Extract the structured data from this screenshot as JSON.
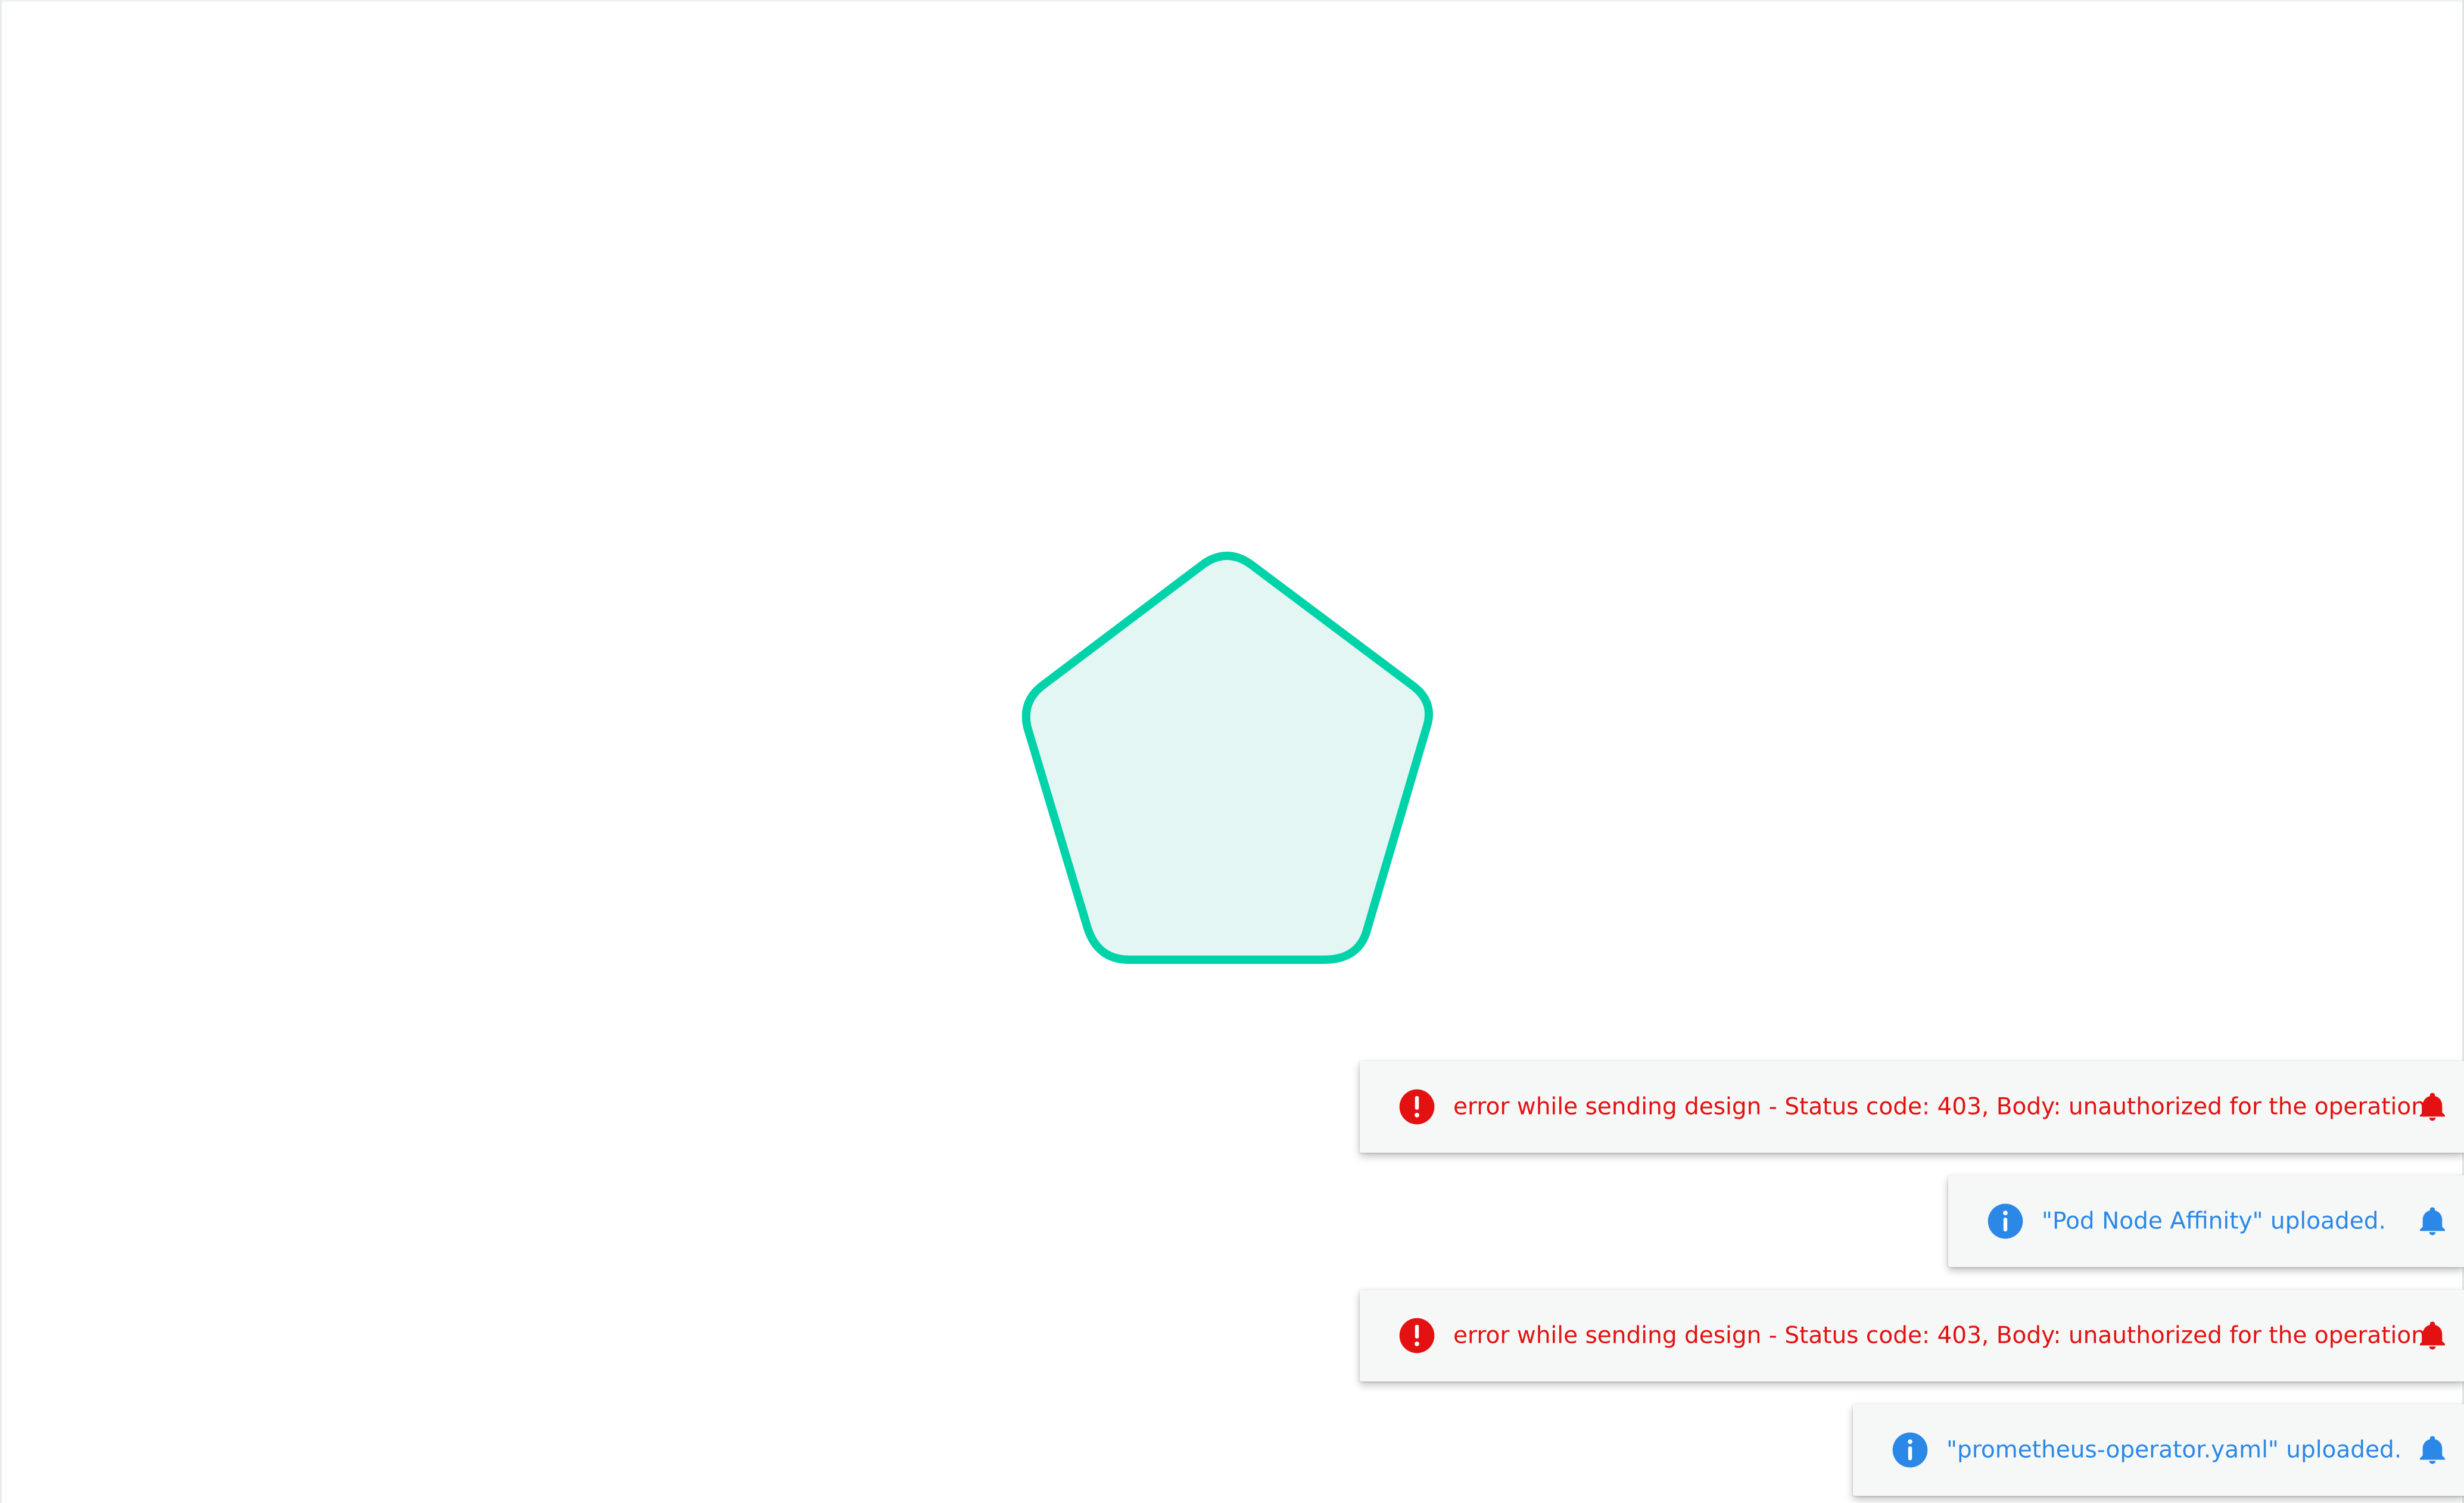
{
  "colors": {
    "accent": "#00d3a9",
    "canvas_background": "#ffffff",
    "error": "#e31111",
    "info": "#2b88e7"
  },
  "canvas": {
    "shape": "pentagon",
    "shape_icon": "pentagon-icon"
  },
  "notifications": [
    {
      "type": "error",
      "status_icon": "error-icon",
      "message": "error while sending design - Status code: 403, Body: unauthorized for the operation",
      "action_icon": "bell-icon"
    },
    {
      "type": "info",
      "status_icon": "info-icon",
      "message": "\"Pod Node Affinity\" uploaded.",
      "action_icon": "bell-icon"
    },
    {
      "type": "error",
      "status_icon": "error-icon",
      "message": "error while sending design - Status code: 403, Body: unauthorized for the operation",
      "action_icon": "bell-icon"
    },
    {
      "type": "info",
      "status_icon": "info-icon",
      "message": "\"prometheus-operator.yaml\" uploaded.",
      "action_icon": "bell-icon"
    }
  ]
}
